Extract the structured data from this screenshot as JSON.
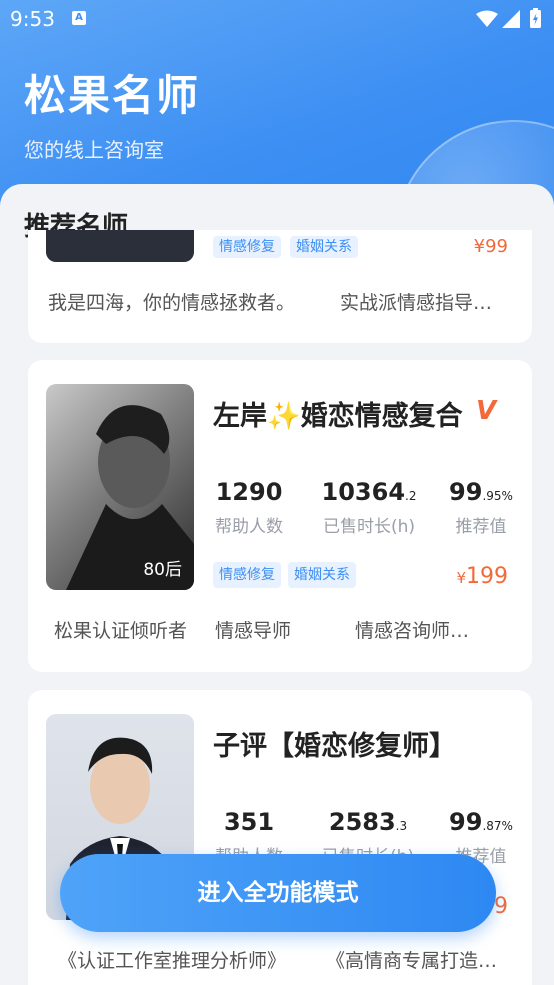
{
  "status_bar": {
    "time": "9:53",
    "notif_icon_letter": "A"
  },
  "header": {
    "title": "松果名师",
    "subtitle": "您的线上咨询室"
  },
  "section": {
    "title": "推荐名师"
  },
  "cards": [
    {
      "partial_tags": [
        "情感修复",
        "婚姻关系"
      ],
      "partial_price": "¥99",
      "footer": [
        "我是四海，你的情感拯救者。",
        "实战派情感指导…"
      ]
    },
    {
      "name": "左岸",
      "name_suffix": "婚恋情感复合",
      "sparkle": "✨",
      "badge": "V",
      "age": "80后",
      "stats": [
        {
          "value": "1290",
          "decimal": "",
          "label": "帮助人数"
        },
        {
          "value": "10364",
          "decimal": ".2",
          "label": "已售时长(h)"
        },
        {
          "value": "99",
          "decimal": ".95%",
          "label": "推荐值"
        }
      ],
      "tags": [
        "情感修复",
        "婚姻关系"
      ],
      "price_symbol": "¥",
      "price": "199",
      "footer": [
        "松果认证倾听者",
        "情感导师",
        "情感咨询师…"
      ]
    },
    {
      "name": "子评【婚恋修复师】",
      "stats": [
        {
          "value": "351",
          "decimal": "",
          "label": "帮助人数"
        },
        {
          "value": "2583",
          "decimal": ".3",
          "label": "已售时长(h)"
        },
        {
          "value": "99",
          "decimal": ".87%",
          "label": "推荐值"
        }
      ],
      "price_partial": "9",
      "footer": [
        "《认证工作室推理分析师》",
        "《高情商专属打造…"
      ]
    }
  ],
  "cta": {
    "label": "进入全功能模式"
  },
  "colors": {
    "brand": "#3d8ff3",
    "price": "#f26a3a",
    "tag_bg": "#e7f1ff"
  }
}
